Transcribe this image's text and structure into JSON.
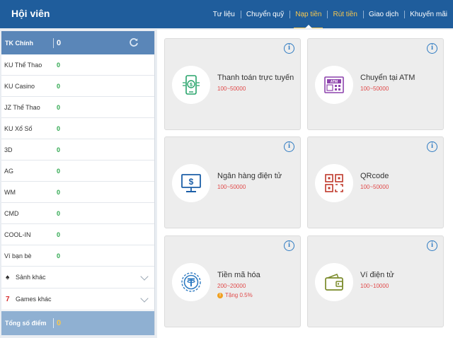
{
  "header": {
    "title": "Hội viên",
    "nav": [
      "Tư liệu",
      "Chuyển quỹ",
      "Nạp tiền",
      "Rút tiền",
      "Giao dịch",
      "Khuyến mãi"
    ]
  },
  "sidebar": {
    "main_label": "TK Chính",
    "main_value": "0",
    "rows": [
      {
        "label": "KU Thể Thao",
        "value": "0"
      },
      {
        "label": "KU Casino",
        "value": "0"
      },
      {
        "label": "JZ Thể Thao",
        "value": "0"
      },
      {
        "label": "KU Xổ Số",
        "value": "0"
      },
      {
        "label": "3D",
        "value": "0"
      },
      {
        "label": "AG",
        "value": "0"
      },
      {
        "label": "WM",
        "value": "0"
      },
      {
        "label": "CMD",
        "value": "0"
      },
      {
        "label": "COOL-IN",
        "value": "0"
      },
      {
        "label": "Ví bạn bè",
        "value": "0"
      }
    ],
    "expanders": [
      {
        "icon": "♠",
        "label": "Sảnh khác"
      },
      {
        "icon": "7",
        "label": "Games khác"
      }
    ],
    "total_label": "Tổng số điểm",
    "total_value": "0"
  },
  "cards": [
    {
      "name": "Thanh toán trực tuyến",
      "range": "100~50000",
      "icon": "mobile-payment-icon"
    },
    {
      "name": "Chuyển tại ATM",
      "range": "100~50000",
      "icon": "atm-icon"
    },
    {
      "name": "Ngân hàng điện tử",
      "range": "100~50000",
      "icon": "monitor-dollar-icon"
    },
    {
      "name": "QRcode",
      "range": "100~50000",
      "icon": "qrcode-icon"
    },
    {
      "name": "Tiền mã hóa",
      "range": "200~20000",
      "bonus": "Tặng 0.5%",
      "icon": "tether-coin-icon"
    },
    {
      "name": "Ví điện tử",
      "range": "100~10000",
      "icon": "wallet-icon"
    }
  ],
  "colors": {
    "header": "#1f5d9c",
    "accent": "#f6c74f",
    "value_green": "#2fa84f",
    "range_red": "#e04a4a",
    "icon_blue": "#2f7bc2"
  }
}
